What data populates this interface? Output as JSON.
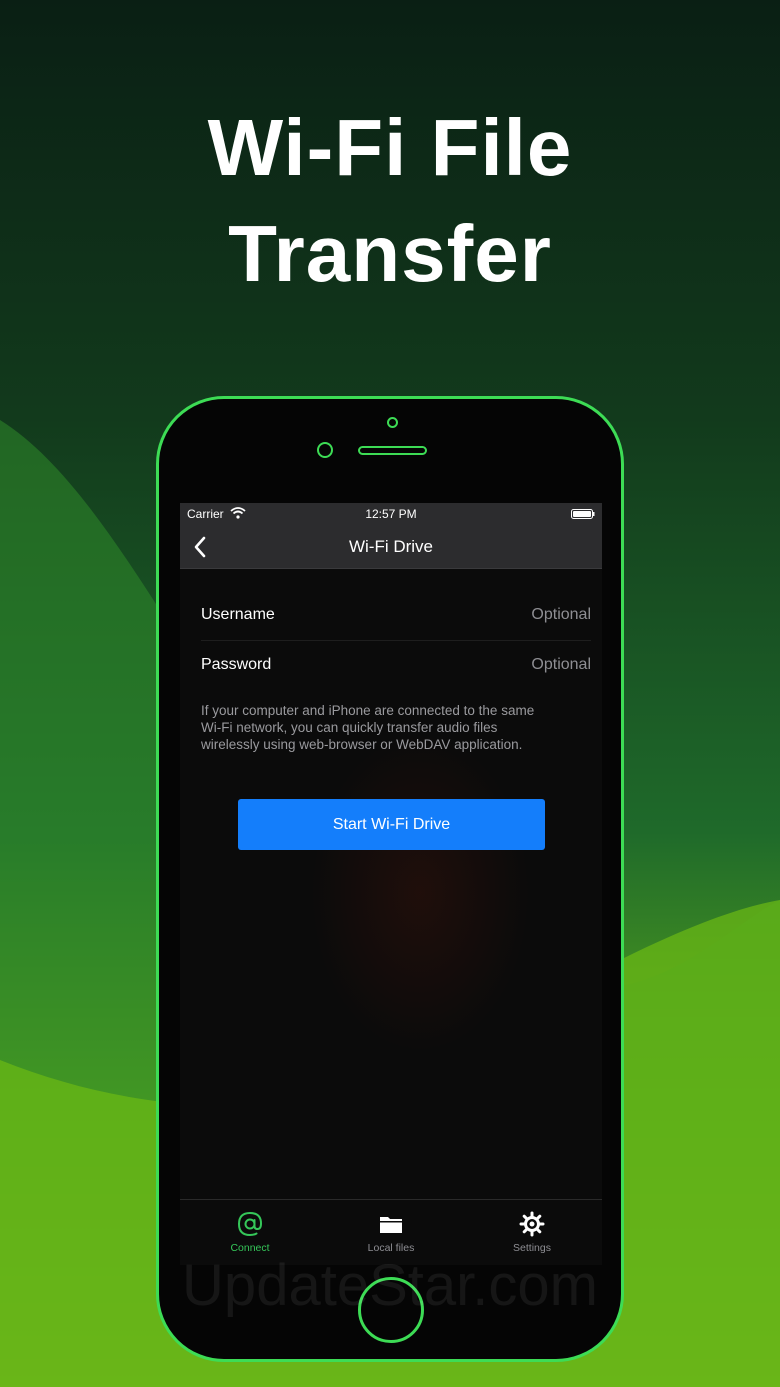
{
  "headline": {
    "line1": "Wi-Fi File",
    "line2": "Transfer"
  },
  "status_bar": {
    "carrier": "Carrier",
    "time": "12:57 PM"
  },
  "nav": {
    "title": "Wi-Fi Drive"
  },
  "form": {
    "username": {
      "label": "Username",
      "placeholder": "Optional",
      "value": ""
    },
    "password": {
      "label": "Password",
      "placeholder": "Optional",
      "value": ""
    }
  },
  "info_text": {
    "line1": "If your computer and iPhone are connected to the same",
    "line2": "Wi-Fi network, you can quickly transfer audio files",
    "line3": "wirelessly using web-browser or WebDAV application."
  },
  "start_button": {
    "label": "Start Wi-Fi Drive"
  },
  "tabs": [
    {
      "label": "Connect",
      "icon": "at-sign-icon",
      "active": true
    },
    {
      "label": "Local files",
      "icon": "folder-icon",
      "active": false
    },
    {
      "label": "Settings",
      "icon": "gear-icon",
      "active": false
    }
  ],
  "watermark": "UpdateStar.com",
  "colors": {
    "accent_green": "#3ddc55",
    "button_blue": "#147efb",
    "active_tab": "#35c759"
  }
}
